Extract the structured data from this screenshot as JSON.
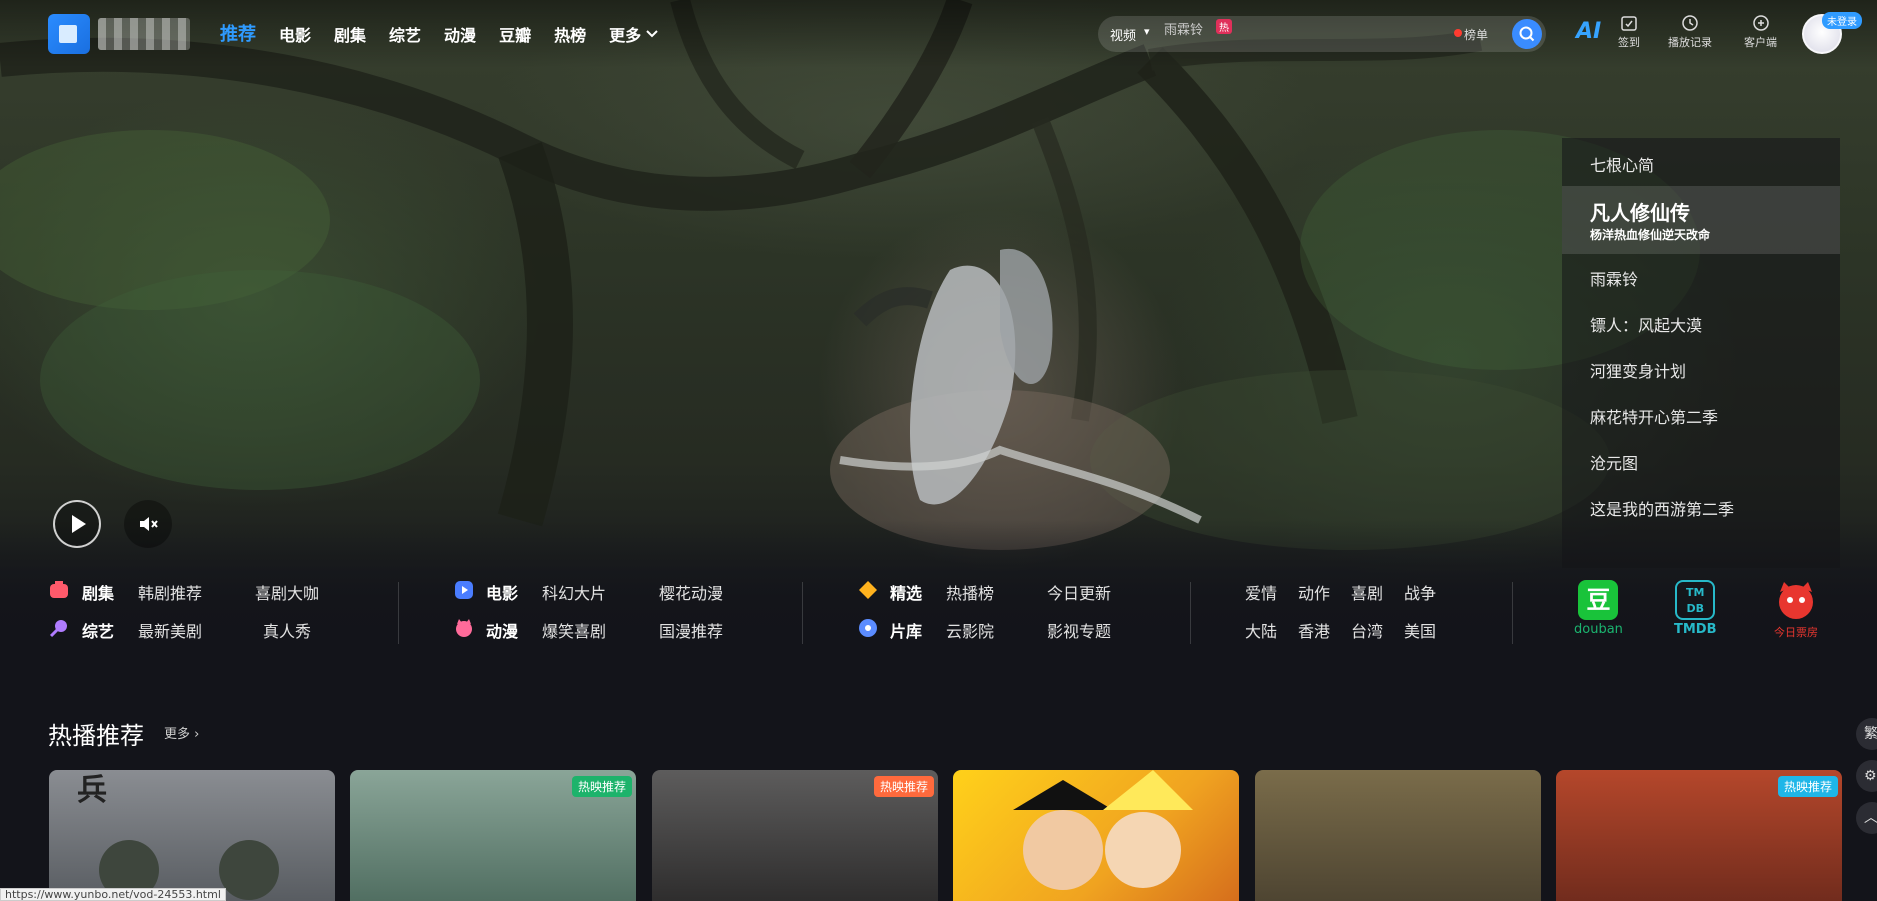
{
  "topbar": {
    "nav": [
      "推荐",
      "电影",
      "剧集",
      "综艺",
      "动漫",
      "豆瓣",
      "热榜"
    ],
    "nav_more": "更多",
    "search": {
      "category": "视频",
      "placeholder": "雨霖铃",
      "hot_badge": "热",
      "rank_label": "榜单"
    },
    "ai_label": "AI",
    "tools": [
      "签到",
      "播放记录",
      "客户端"
    ],
    "login_badge": "未登录"
  },
  "playlist": {
    "items": [
      "七根心简",
      "雨霖铃",
      "镖人：风起大漠",
      "河狸变身计划",
      "麻花特开心第二季",
      "沧元图",
      "这是我的西游第二季"
    ],
    "active": {
      "title": "凡人修仙传",
      "subtitle": "杨洋热血修仙逆天改命"
    }
  },
  "categories": {
    "group1": {
      "row1": {
        "main": "剧集",
        "a": "韩剧推荐",
        "b": "喜剧大咖"
      },
      "row2": {
        "main": "综艺",
        "a": "最新美剧",
        "b": "真人秀"
      }
    },
    "group2": {
      "row1": {
        "main": "电影",
        "a": "科幻大片",
        "b": "樱花动漫"
      },
      "row2": {
        "main": "动漫",
        "a": "爆笑喜剧",
        "b": "国漫推荐"
      }
    },
    "group3": {
      "row1": {
        "main": "精选",
        "a": "热播榜",
        "b": "今日更新"
      },
      "row2": {
        "main": "片库",
        "a": "云影院",
        "b": "影视专题"
      }
    },
    "group4": {
      "row1": [
        "爱情",
        "动作",
        "喜剧",
        "战争"
      ],
      "row2": [
        "大陆",
        "香港",
        "台湾",
        "美国"
      ]
    }
  },
  "brands": {
    "douban_icon": "豆",
    "douban": "douban",
    "tmdb_icon": "TM DB",
    "tmdb": "TMDB",
    "maoyan": "今日票房"
  },
  "section": {
    "title": "热播推荐",
    "more": "更多",
    "cards": [
      {
        "tag": "",
        "tag_color": ""
      },
      {
        "tag": "热映推荐",
        "tag_color": "#1db36b"
      },
      {
        "tag": "热映推荐",
        "tag_color": "#ff6a3d"
      },
      {
        "tag": "",
        "tag_color": ""
      },
      {
        "tag": "",
        "tag_color": ""
      },
      {
        "tag": "热映推荐",
        "tag_color": "#1fb6e8"
      }
    ]
  },
  "side_buttons": [
    "繁",
    "⚙",
    "︿"
  ],
  "status_url": "https://www.yunbo.net/vod-24553.html",
  "colors": {
    "accent": "#2f9bff",
    "bg": "#13141a"
  }
}
